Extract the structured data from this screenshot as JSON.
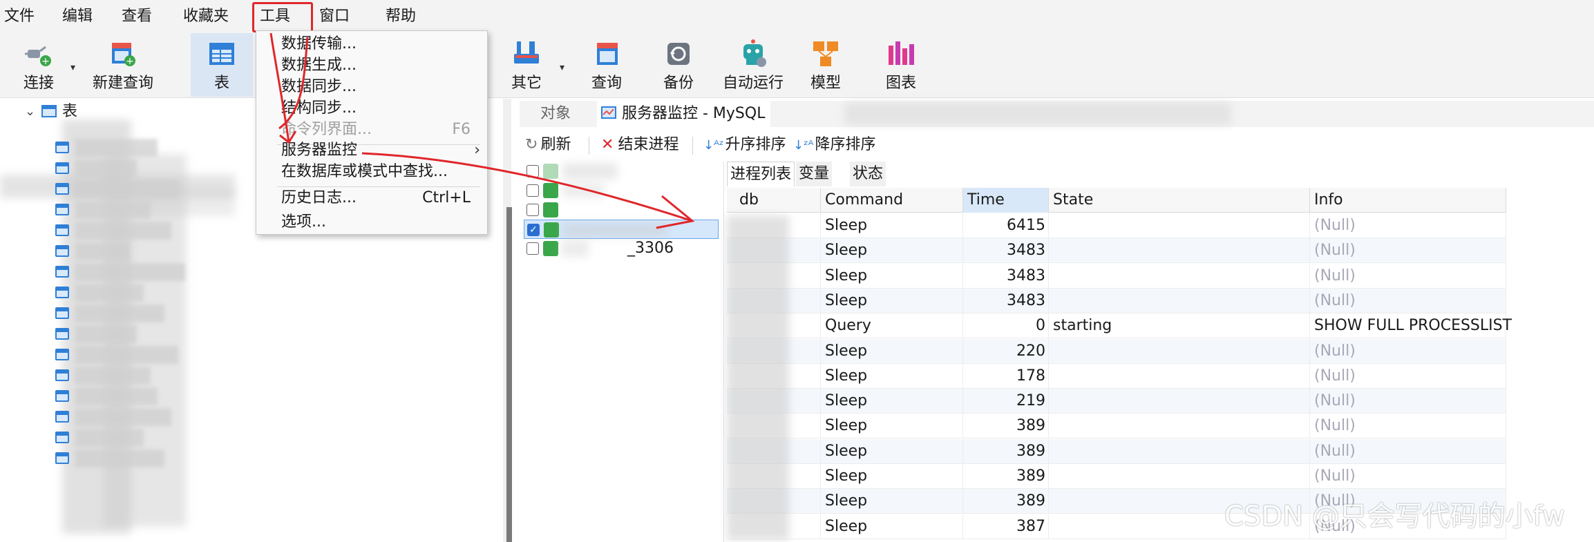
{
  "menubar": {
    "items": [
      "文件",
      "编辑",
      "查看",
      "收藏夹",
      "工具",
      "窗口",
      "帮助"
    ]
  },
  "toolbar": {
    "buttons": [
      {
        "label": "连接",
        "icon": "plug-icon"
      },
      {
        "label": "新建查询",
        "icon": "new-query-icon"
      },
      {
        "label": "表",
        "icon": "table-icon"
      },
      {
        "label": "其它",
        "icon": "tools-icon"
      },
      {
        "label": "查询",
        "icon": "query-icon"
      },
      {
        "label": "备份",
        "icon": "backup-icon"
      },
      {
        "label": "自动运行",
        "icon": "robot-icon"
      },
      {
        "label": "模型",
        "icon": "model-icon"
      },
      {
        "label": "图表",
        "icon": "chart-icon"
      }
    ]
  },
  "tree": {
    "root_label": "表"
  },
  "tools_menu": {
    "items": [
      {
        "label": "数据传输...",
        "shortcut": "",
        "disabled": false,
        "submenu": false
      },
      {
        "label": "数据生成...",
        "shortcut": "",
        "disabled": false,
        "submenu": false
      },
      {
        "label": "数据同步...",
        "shortcut": "",
        "disabled": false,
        "submenu": false
      },
      {
        "label": "结构同步...",
        "shortcut": "",
        "disabled": false,
        "submenu": false
      },
      {
        "label": "命令列界面...",
        "shortcut": "F6",
        "disabled": true,
        "submenu": false
      },
      {
        "label": "服务器监控",
        "shortcut": "",
        "disabled": false,
        "submenu": true
      },
      {
        "label": "在数据库或模式中查找...",
        "shortcut": "",
        "disabled": false,
        "submenu": false
      },
      {
        "label": "历史日志...",
        "shortcut": "Ctrl+L",
        "disabled": false,
        "submenu": false
      },
      {
        "label": "选项...",
        "shortcut": "",
        "disabled": false,
        "submenu": false
      }
    ],
    "submenu_arrow": "›"
  },
  "doc_tabs": {
    "objects_label": "对象",
    "active_label": "服务器监控 - MySQL"
  },
  "monitor_toolbar": {
    "refresh": "刷新",
    "kill": "结束进程",
    "sort_asc": "升序排序",
    "sort_desc": "降序排序"
  },
  "servers": {
    "visible_label": "_3306"
  },
  "process_tabs": [
    "进程列表",
    "变量",
    "状态"
  ],
  "grid": {
    "columns": [
      "db",
      "Command",
      "Time",
      "State",
      "Info"
    ],
    "rows": [
      {
        "db": "",
        "command": "Sleep",
        "time": "6415",
        "state": "",
        "info": "(Null)"
      },
      {
        "db": "",
        "command": "Sleep",
        "time": "3483",
        "state": "",
        "info": "(Null)"
      },
      {
        "db": "",
        "command": "Sleep",
        "time": "3483",
        "state": "",
        "info": "(Null)"
      },
      {
        "db": "",
        "command": "Sleep",
        "time": "3483",
        "state": "",
        "info": "(Null)"
      },
      {
        "db": "",
        "command": "Query",
        "time": "0",
        "state": "starting",
        "info": "SHOW FULL PROCESSLIST"
      },
      {
        "db": "",
        "command": "Sleep",
        "time": "220",
        "state": "",
        "info": "(Null)"
      },
      {
        "db": "",
        "command": "Sleep",
        "time": "178",
        "state": "",
        "info": "(Null)"
      },
      {
        "db": "",
        "command": "Sleep",
        "time": "219",
        "state": "",
        "info": "(Null)"
      },
      {
        "db": "",
        "command": "Sleep",
        "time": "389",
        "state": "",
        "info": "(Null)"
      },
      {
        "db": "",
        "command": "Sleep",
        "time": "389",
        "state": "",
        "info": "(Null)"
      },
      {
        "db": "",
        "command": "Sleep",
        "time": "389",
        "state": "",
        "info": "(Null)"
      },
      {
        "db": "",
        "command": "Sleep",
        "time": "389",
        "state": "",
        "info": "(Null)"
      },
      {
        "db": "",
        "command": "Sleep",
        "time": "387",
        "state": "",
        "info": "(Null)"
      }
    ]
  },
  "watermark": "CSDN @只会写代码的小fw",
  "colors": {
    "annotation": "#e0262a",
    "selection": "#d5e7fb",
    "null_text": "#a8a8b8"
  }
}
